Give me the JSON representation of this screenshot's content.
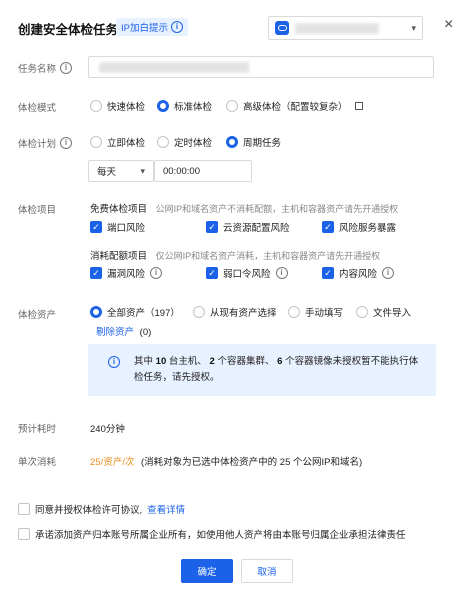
{
  "header": {
    "title": "创建安全体检任务",
    "ip_tag": "IP加白提示",
    "account_select_value": "",
    "close_glyph": "×"
  },
  "form": {
    "task_name": {
      "label": "任务名称",
      "value": ""
    },
    "mode": {
      "label": "体检模式",
      "options": [
        "快速体检",
        "标准体检",
        "高级体检（配置较复杂）"
      ],
      "selected": "标准体检"
    },
    "plan": {
      "label": "体检计划",
      "options": [
        "立即体检",
        "定时体检",
        "周期任务"
      ],
      "selected": "周期任务",
      "frequency": "每天",
      "time": "00:00:00"
    },
    "items": {
      "label": "体检项目",
      "free": {
        "title": "免费体检项目",
        "desc": "公网IP和域名资产不消耗配额，主机和容器资产请先开通授权",
        "checks": [
          "端口风险",
          "云资源配置风险",
          "风险服务暴露"
        ]
      },
      "paid": {
        "title": "消耗配额项目",
        "desc": "仅公网IP和域名资产消耗，主机和容器资产请先开通授权",
        "checks": [
          "漏洞风险",
          "弱口令风险",
          "内容风险"
        ]
      }
    },
    "assets": {
      "label": "体检资产",
      "options": [
        "全部资产（197）",
        "从现有资产选择",
        "手动填写",
        "文件导入"
      ],
      "selected": "全部资产（197）",
      "remove_link": "剔除资产",
      "remove_count": "(0)"
    },
    "notice": {
      "p1": "其中",
      "n1": "10",
      "p2": "台主机、",
      "n2": "2",
      "p3": "个容器集群、",
      "n3": "6",
      "p4": "个容器镜像未授权暂不能执行体检任务，请先授权。"
    },
    "eta": {
      "label": "预计耗时",
      "value": "240分钟"
    },
    "cost": {
      "label": "单次消耗",
      "value": "25/资产/次",
      "desc": "(消耗对象为已选中体检资产中的 25 个公网IP和域名)"
    }
  },
  "agreements": {
    "a1": "同意并授权体检许可协议,",
    "a1_link": "查看详情",
    "a2": "承诺添加资产归本账号所属企业所有，如使用他人资产将由本账号归属企业承担法律责任"
  },
  "buttons": {
    "confirm": "确定",
    "cancel": "取消"
  },
  "colors": {
    "accent": "#1b62e8",
    "notice_bg": "#e8f1ff",
    "cost_text": "#e88e1f"
  }
}
